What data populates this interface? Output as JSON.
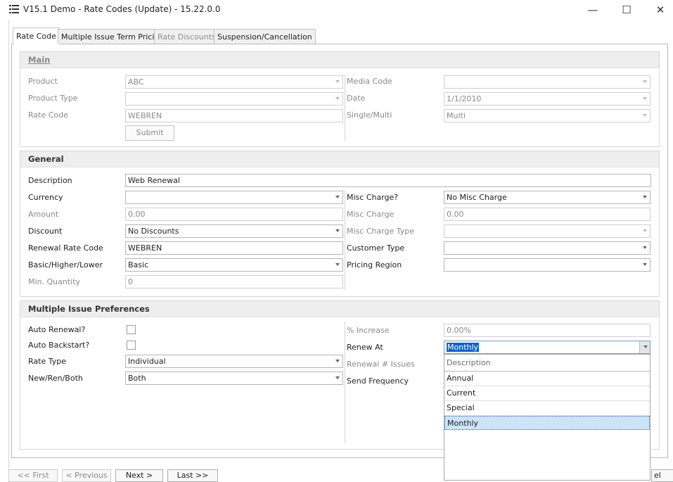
{
  "window": {
    "title": "V15.1 Demo - Rate Codes (Update) - 15.22.0.0",
    "minimize_glyph": "—",
    "maximize_glyph": "☐",
    "close_glyph": "✕"
  },
  "tabs": [
    {
      "label": "Rate Code",
      "active": true
    },
    {
      "label": "Multiple Issue Term Pricing"
    },
    {
      "label": "Rate Discounts",
      "disabled": true
    },
    {
      "label": "Suspension/Cancellation"
    }
  ],
  "main": {
    "heading": "Main",
    "product_label": "Product",
    "product_value": "ABC",
    "product_type_label": "Product Type",
    "product_type_value": "",
    "rate_code_label": "Rate Code",
    "rate_code_value": "WEBREN",
    "submit_label": "Submit",
    "media_code_label": "Media Code",
    "media_code_value": "",
    "date_label": "Date",
    "date_value": "1/1/2010",
    "single_multi_label": "Single/Multi",
    "single_multi_value": "Multi"
  },
  "general": {
    "heading": "General",
    "description_label": "Description",
    "description_value": "Web Renewal",
    "currency_label": "Currency",
    "currency_value": "",
    "amount_label": "Amount",
    "amount_value": "0.00",
    "discount_label": "Discount",
    "discount_value": "No Discounts",
    "renewal_rate_code_label": "Renewal Rate Code",
    "renewal_rate_code_value": "WEBREN",
    "basic_label": "Basic/Higher/Lower",
    "basic_value": "Basic",
    "min_quantity_label": "Min. Quantity",
    "min_quantity_value": "0",
    "misc_charge_q_label": "Misc Charge?",
    "misc_charge_q_value": "No Misc Charge",
    "misc_charge_label": "Misc Charge",
    "misc_charge_value": "0.00",
    "misc_charge_type_label": "Misc Charge Type",
    "misc_charge_type_value": "",
    "customer_type_label": "Customer Type",
    "customer_type_value": "",
    "pricing_region_label": "Pricing Region",
    "pricing_region_value": ""
  },
  "multi_issue": {
    "heading": "Multiple Issue Preferences",
    "auto_renewal_label": "Auto Renewal?",
    "auto_backstart_label": "Auto Backstart?",
    "rate_type_label": "Rate Type",
    "rate_type_value": "Individual",
    "new_ren_both_label": "New/Ren/Both",
    "new_ren_both_value": "Both",
    "pct_increase_label": "% Increase",
    "pct_increase_value": "0.00%",
    "renew_at_label": "Renew At",
    "renew_at_value": "Monthly",
    "renewal_issues_label": "Renewal # Issues",
    "send_frequency_label": "Send Frequency"
  },
  "dropdown": {
    "header": "Description",
    "options": [
      "Annual",
      "Current",
      "Special",
      "Monthly"
    ],
    "selected": "Monthly"
  },
  "nav": {
    "first": "<< First",
    "previous": "< Previous",
    "next": "Next >",
    "last": "Last >>",
    "cancel_partial": "el"
  }
}
